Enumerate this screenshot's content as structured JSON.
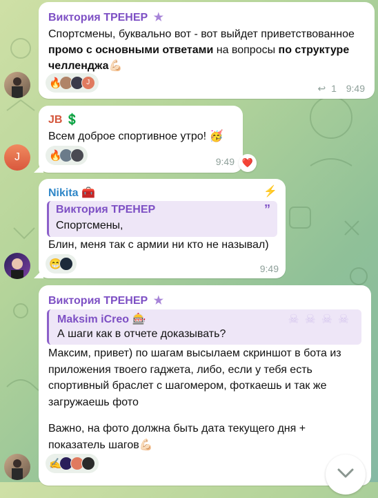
{
  "messages": [
    {
      "sender": "Виктория ТРЕНЕР",
      "text_part1": "Спортсмены, буквально вот - вот выйдет приветствованное ",
      "text_bold1": "промо с основными ответами",
      "text_part2": " на вопросы ",
      "text_bold2": "по структуре челленджа",
      "reactions": [
        "🔥"
      ],
      "reply_count": "1",
      "time": "9:49"
    },
    {
      "sender": "JB",
      "sender_emoji": "💲",
      "text": "Всем доброе спортивное утро!",
      "text_emoji": "🥳",
      "reactions": [
        "🔥"
      ],
      "time": "9:49",
      "extra_reaction": "❤️"
    },
    {
      "sender": "Nikita",
      "sender_emoji": "🧰",
      "quote_author": "Виктория ТРЕНЕР",
      "quote_text": "Спортсмены,",
      "text": "Блин, меня так с армии ни кто не называл)",
      "reactions": [
        "😁"
      ],
      "time": "9:49"
    },
    {
      "sender": "Виктория ТРЕНЕР",
      "quote_author": "Maksim iCreo",
      "quote_author_emoji": "🎰",
      "quote_text": "А шаги как в отчете доказывать?",
      "text_p1": "Максим, привет) по шагам высылаем скриншот в бота из приложения твоего гаджета, либо, если у тебя есть спортивный браслет с шагомером, фоткаешь и так же загружаешь фото",
      "text_p2": "Важно, на фото должна быть дата текущего дня + показатель шагов",
      "text_p2_emoji": "💪🏻",
      "reactions": [
        "✍"
      ]
    }
  ],
  "colors": {
    "purple": "#7d4fc4",
    "orange": "#d4553b",
    "blue": "#2f87c8",
    "accent_bg": "#eaf0ea"
  },
  "icons": [
    "star-icon",
    "reply-arrow-icon",
    "lightning-icon",
    "quote-mark-icon",
    "chevron-down-icon"
  ]
}
